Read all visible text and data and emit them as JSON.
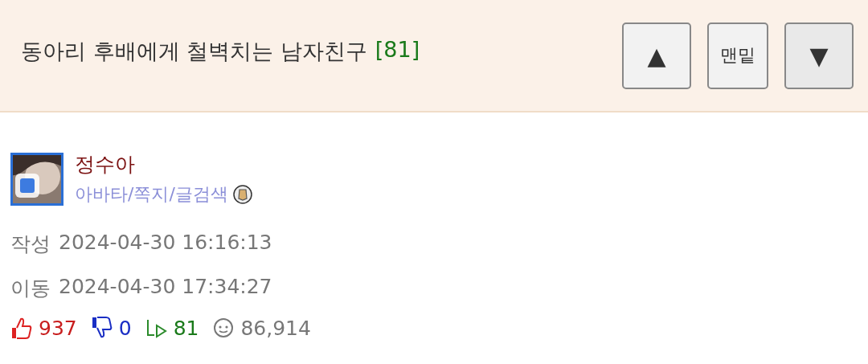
{
  "header": {
    "title": "동아리 후배에게 철벽치는 남자친구",
    "comment_count": "[81]",
    "buttons": [
      {
        "kind": "up",
        "label": "▲"
      },
      {
        "kind": "bottom",
        "label": "맨밑"
      },
      {
        "kind": "down",
        "label": "▼"
      }
    ]
  },
  "author": {
    "name": "정수아",
    "links": "아바타/쪽지/글검색"
  },
  "meta": [
    {
      "label": "작성",
      "value": "2024-04-30 16:16:13"
    },
    {
      "label": "이동",
      "value": "2024-04-30 17:34:27"
    }
  ],
  "stats": {
    "likes": "937",
    "dislikes": "0",
    "comments": "81",
    "views": "86,914"
  }
}
